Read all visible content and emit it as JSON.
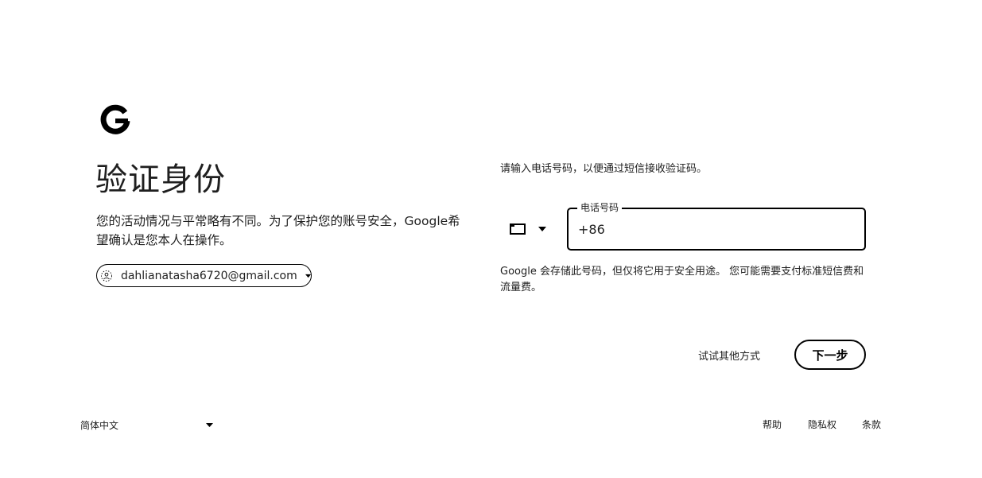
{
  "logo": {
    "icon": "google-g-icon"
  },
  "page": {
    "title": "验证身份",
    "description": "您的活动情况与平常略有不同。为了保护您的账号安全，Google希望确认是您本人在操作。"
  },
  "account": {
    "email": "dahlianatasha6720@gmail.com",
    "avatar_icon": "account-avatar-icon",
    "dropdown_icon": "chevron-down-icon"
  },
  "form": {
    "instruction": "请输入电话号码，以便通过短信接收验证码。",
    "country_flag_icon": "flag-icon",
    "phone_label": "电话号码",
    "phone_value": "+86",
    "notice": "Google 会存储此号码，但仅将它用于安全用途。 您可能需要支付标准短信费和流量费。"
  },
  "actions": {
    "try_other": "试试其他方式",
    "next": "下一步"
  },
  "footer": {
    "language": "简体中文",
    "help": "帮助",
    "privacy": "隐私权",
    "terms": "条款"
  },
  "colors": {
    "text": "#1f1f1f",
    "border": "#000000",
    "background": "#ffffff"
  }
}
